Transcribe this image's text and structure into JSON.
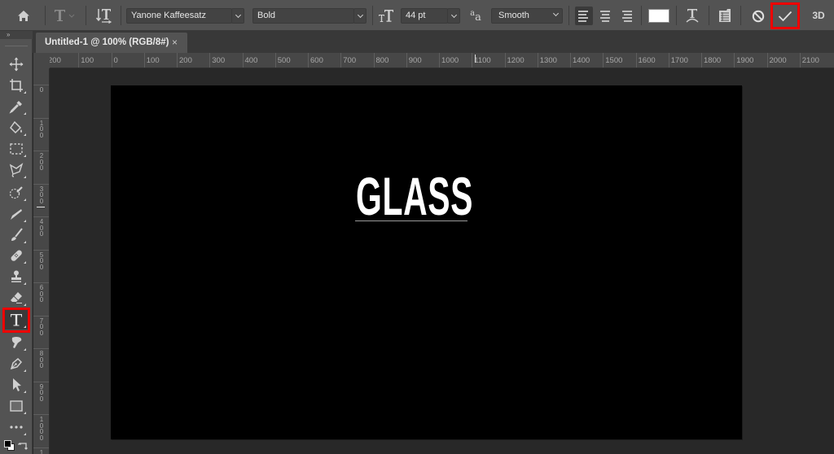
{
  "options_bar": {
    "home_icon": "home-icon",
    "tool_preset_icon": "type-tool-icon",
    "orientation_icon": "text-orientation-icon",
    "font_family": "Yanone Kaffeesatz",
    "font_style": "Bold",
    "font_size_icon": "font-size-icon",
    "font_size": "44 pt",
    "antialias_icon": "antialias-icon",
    "antialias": "Smooth",
    "align_left": "align-left-icon",
    "align_center": "align-center-icon",
    "align_right": "align-right-icon",
    "active_alignment": "left",
    "text_color": "#ffffff",
    "warp_icon": "warp-text-icon",
    "panels_icon": "character-paragraph-panels-icon",
    "cancel_icon": "cancel-icon",
    "commit_icon": "commit-checkmark-icon",
    "three_d_label": "3D"
  },
  "panel_collapse_label": "»",
  "document_tab": {
    "title": "Untitled-1 @ 100% (RGB/8#)",
    "close": "×"
  },
  "tools": [
    {
      "name": "move-tool",
      "icon": "move-icon"
    },
    {
      "name": "crop-tool",
      "icon": "crop-icon"
    },
    {
      "name": "eyedropper-tool",
      "icon": "eyedropper-icon"
    },
    {
      "name": "paint-bucket-tool",
      "icon": "paint-bucket-icon"
    },
    {
      "name": "rectangular-marquee-tool",
      "icon": "marquee-icon"
    },
    {
      "name": "lasso-tool",
      "icon": "lasso-icon"
    },
    {
      "name": "quick-selection-tool",
      "icon": "quick-selection-icon"
    },
    {
      "name": "gradient-tool",
      "icon": "gradient-icon"
    },
    {
      "name": "brush-tool",
      "icon": "brush-icon"
    },
    {
      "name": "healing-brush-tool",
      "icon": "bandage-icon"
    },
    {
      "name": "clone-stamp-tool",
      "icon": "stamp-icon"
    },
    {
      "name": "eraser-tool",
      "icon": "eraser-icon"
    },
    {
      "name": "type-tool",
      "icon": "type-icon",
      "selected": true
    },
    {
      "name": "smudge-tool",
      "icon": "smudge-icon"
    },
    {
      "name": "pen-tool",
      "icon": "pen-icon"
    },
    {
      "name": "path-selection-tool",
      "icon": "arrow-icon"
    },
    {
      "name": "rectangle-tool",
      "icon": "rectangle-icon"
    },
    {
      "name": "edit-toolbar",
      "icon": "more-icon"
    },
    {
      "name": "color-swatches",
      "icon": "fg-bg-color-icon"
    }
  ],
  "hruler": {
    "labels": [
      "200",
      "100",
      "0",
      "100",
      "200",
      "300",
      "400",
      "500",
      "600",
      "700",
      "800",
      "900",
      "1000",
      "1100",
      "1200",
      "1300",
      "1400",
      "1500",
      "1600",
      "1700",
      "1800",
      "1900",
      "2000",
      "2100"
    ]
  },
  "vruler": {
    "labels": [
      "0",
      "100",
      "200",
      "300",
      "400",
      "500",
      "600",
      "700",
      "800",
      "900",
      "1000",
      "1"
    ]
  },
  "canvas": {
    "background": "#000000",
    "text": "GLASS",
    "text_color": "#ffffff"
  }
}
